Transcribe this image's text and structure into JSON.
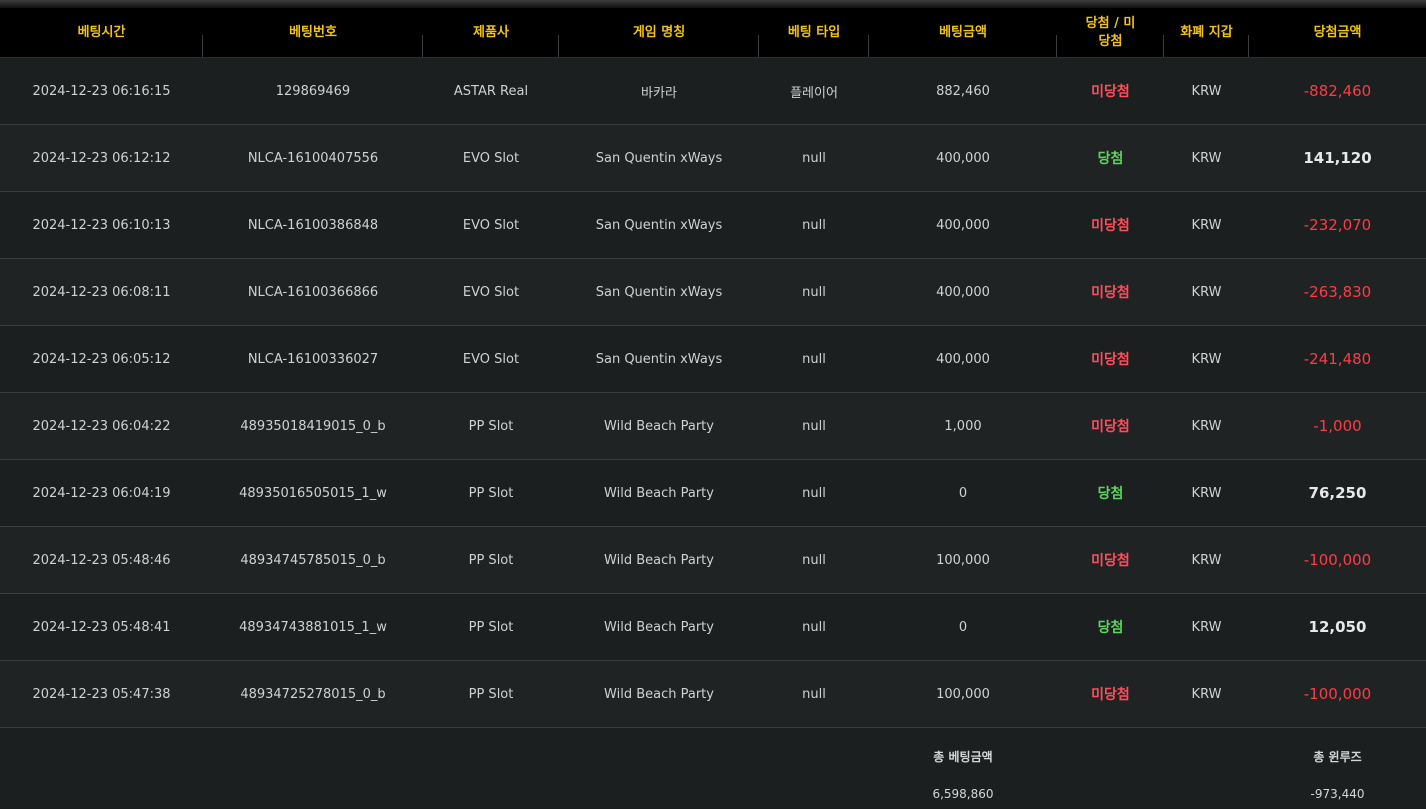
{
  "headers": [
    "베팅시간",
    "베팅번호",
    "제품사",
    "게임 명칭",
    "베팅 타입",
    "베팅금액",
    "당첨 / 미당첨",
    "화폐 지갑",
    "당첨금액"
  ],
  "rows": [
    {
      "time": "2024-12-23 06:16:15",
      "id": "129869469",
      "provider": "ASTAR Real",
      "game": "바카라",
      "type": "플레이어",
      "bet": "882,460",
      "result": "미당첨",
      "win": false,
      "currency": "KRW",
      "payout": "-882,460",
      "negative": true
    },
    {
      "time": "2024-12-23 06:12:12",
      "id": "NLCA-16100407556",
      "provider": "EVO Slot",
      "game": "San Quentin xWays",
      "type": "null",
      "bet": "400,000",
      "result": "당첨",
      "win": true,
      "currency": "KRW",
      "payout": "141,120",
      "negative": false
    },
    {
      "time": "2024-12-23 06:10:13",
      "id": "NLCA-16100386848",
      "provider": "EVO Slot",
      "game": "San Quentin xWays",
      "type": "null",
      "bet": "400,000",
      "result": "미당첨",
      "win": false,
      "currency": "KRW",
      "payout": "-232,070",
      "negative": true
    },
    {
      "time": "2024-12-23 06:08:11",
      "id": "NLCA-16100366866",
      "provider": "EVO Slot",
      "game": "San Quentin xWays",
      "type": "null",
      "bet": "400,000",
      "result": "미당첨",
      "win": false,
      "currency": "KRW",
      "payout": "-263,830",
      "negative": true
    },
    {
      "time": "2024-12-23 06:05:12",
      "id": "NLCA-16100336027",
      "provider": "EVO Slot",
      "game": "San Quentin xWays",
      "type": "null",
      "bet": "400,000",
      "result": "미당첨",
      "win": false,
      "currency": "KRW",
      "payout": "-241,480",
      "negative": true
    },
    {
      "time": "2024-12-23 06:04:22",
      "id": "48935018419015_0_b",
      "provider": "PP Slot",
      "game": "Wild Beach Party",
      "type": "null",
      "bet": "1,000",
      "result": "미당첨",
      "win": false,
      "currency": "KRW",
      "payout": "-1,000",
      "negative": true
    },
    {
      "time": "2024-12-23 06:04:19",
      "id": "48935016505015_1_w",
      "provider": "PP Slot",
      "game": "Wild Beach Party",
      "type": "null",
      "bet": "0",
      "result": "당첨",
      "win": true,
      "currency": "KRW",
      "payout": "76,250",
      "negative": false
    },
    {
      "time": "2024-12-23 05:48:46",
      "id": "48934745785015_0_b",
      "provider": "PP Slot",
      "game": "Wild Beach Party",
      "type": "null",
      "bet": "100,000",
      "result": "미당첨",
      "win": false,
      "currency": "KRW",
      "payout": "-100,000",
      "negative": true
    },
    {
      "time": "2024-12-23 05:48:41",
      "id": "48934743881015_1_w",
      "provider": "PP Slot",
      "game": "Wild Beach Party",
      "type": "null",
      "bet": "0",
      "result": "당첨",
      "win": true,
      "currency": "KRW",
      "payout": "12,050",
      "negative": false
    },
    {
      "time": "2024-12-23 05:47:38",
      "id": "48934725278015_0_b",
      "provider": "PP Slot",
      "game": "Wild Beach Party",
      "type": "null",
      "bet": "100,000",
      "result": "미당첨",
      "win": false,
      "currency": "KRW",
      "payout": "-100,000",
      "negative": true
    }
  ],
  "summary": {
    "total_bet_label": "총 베팅금액",
    "total_bet": "6,598,860",
    "total_winloss_label": "총 윈루즈",
    "total_winloss": "-973,440"
  },
  "colors": {
    "header_text": "#f2c21b",
    "win": "#5fd35f",
    "lose": "#ff4d5a",
    "negative_amount": "#ff3b44"
  }
}
